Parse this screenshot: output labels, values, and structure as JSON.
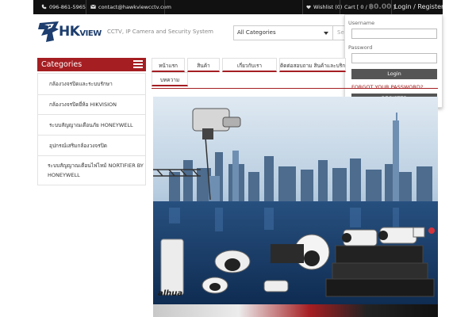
{
  "topbar": {
    "phone": "096-861-5965",
    "email": "contact@hawkviewcctv.com",
    "wishlist": "Wishlist (0)",
    "cart_prefix": "Cart [ 0 /",
    "cart_total": "฿0.00",
    "cart_suffix": "]",
    "login_register": "Login / Register"
  },
  "header": {
    "logo_main": "HK",
    "logo_small": "VIEW",
    "tagline": "CCTV, IP Camera and Security System",
    "category_select": "All Categories",
    "search_placeholder": "Se"
  },
  "login": {
    "username_label": "Username",
    "password_label": "Password",
    "login_button": "Login",
    "forgot_link": "FORGOT YOUR PASSWORD?",
    "register_button": "REGISTER"
  },
  "sidebar": {
    "heading": "Categories",
    "items": [
      {
        "label": "กล้องวงจรปิดและระบบรักษา"
      },
      {
        "label": "กล้องวงจรปิดยี่ห้อ HIKVISION"
      },
      {
        "label": "ระบบสัญญาณเตือนภัย HONEYWELL"
      },
      {
        "label": "อุปกรณ์เสริมกล้องวงจรปิด"
      },
      {
        "label": "ระบบสัญญาณเตือนไฟไหม้ NORTIFIER BY HONEYWELL"
      }
    ]
  },
  "nav": {
    "tabs": [
      {
        "label": "หน้าแรก"
      },
      {
        "label": "สินค้า"
      },
      {
        "label": "เกี่ยวกับเรา"
      },
      {
        "label": "ติดต่อสอบถาม สินค้าและบริการ"
      },
      {
        "label": "บทความ"
      }
    ]
  },
  "banner": {
    "brand": "alhua"
  },
  "colors": {
    "accent": "#a51e22",
    "topbar": "#111111",
    "logo_blue": "#1c3d6e"
  }
}
